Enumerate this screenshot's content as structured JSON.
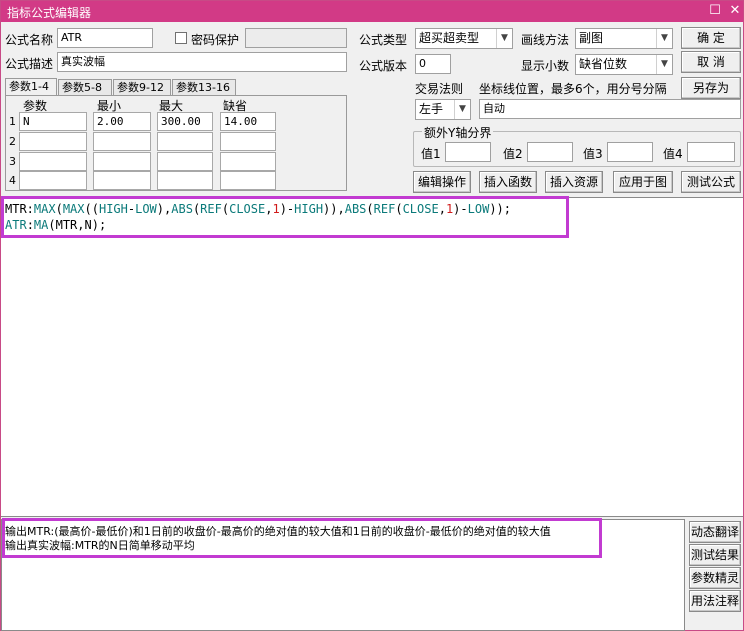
{
  "window": {
    "title": "指标公式编辑器",
    "restore_glyph": "☐",
    "close_glyph": "✕"
  },
  "form": {
    "name_label": "公式名称",
    "name_value": "ATR",
    "password_label": "密码保护",
    "desc_label": "公式描述",
    "desc_value": "真实波幅",
    "type_label": "公式类型",
    "type_value": "超买超卖型",
    "draw_label": "画线方法",
    "draw_value": "副图",
    "version_label": "公式版本",
    "version_value": "0",
    "decimal_label": "显示小数",
    "decimal_value": "缺省位数",
    "trade_label": "交易法则",
    "trade_value": "左手",
    "coord_label": "坐标线位置，最多6个，用分号分隔",
    "coord_value": "自动",
    "yaxis_label": "额外Y轴分界",
    "val1_label": "值1",
    "val2_label": "值2",
    "val3_label": "值3",
    "val4_label": "值4"
  },
  "buttons": {
    "ok": "确  定",
    "cancel": "取  消",
    "save_as": "另存为",
    "edit_ops": "编辑操作",
    "insert_fn": "插入函数",
    "insert_res": "插入资源",
    "apply": "应用于图",
    "test": "测试公式",
    "translate": "动态翻译",
    "test_result": "测试结果",
    "param_tune": "参数精灵",
    "usage": "用法注释"
  },
  "tabs": [
    "参数1-4",
    "参数5-8",
    "参数9-12",
    "参数13-16"
  ],
  "params": {
    "headers": [
      "参数",
      "最小",
      "最大",
      "缺省"
    ],
    "rows": [
      {
        "num": "1",
        "name": "N",
        "min": "2.00",
        "max": "300.00",
        "default": "14.00"
      },
      {
        "num": "2",
        "name": "",
        "min": "",
        "max": "",
        "default": ""
      },
      {
        "num": "3",
        "name": "",
        "min": "",
        "max": "",
        "default": ""
      },
      {
        "num": "4",
        "name": "",
        "min": "",
        "max": "",
        "default": ""
      }
    ]
  },
  "code": {
    "line1": "MTR:MAX(MAX((HIGH-LOW),ABS(REF(CLOSE,1)-HIGH)),ABS(REF(CLOSE,1)-LOW));",
    "line2": "ATR:MA(MTR,N);"
  },
  "output": {
    "line1": "输出MTR:(最高价-最低价)和1日前的收盘价-最高价的绝对值的较大值和1日前的收盘价-最低价的绝对值的较大值",
    "line2": "输出真实波幅:MTR的N日简单移动平均"
  },
  "colors": {
    "titlebar": "#d23a86",
    "highlight": "#c23bd1",
    "keyword": "#0b7a7a",
    "number": "#d01a1a"
  }
}
